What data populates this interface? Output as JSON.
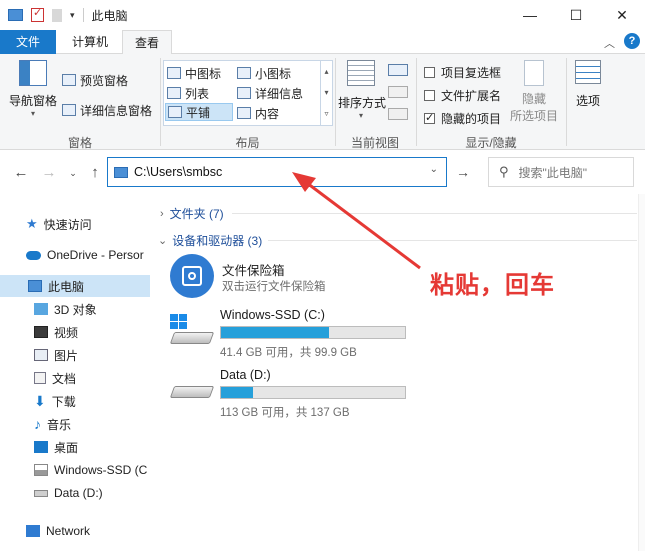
{
  "window": {
    "title": "此电脑",
    "controls": {
      "minimize": "—",
      "maximize": "☐",
      "close": "✕"
    }
  },
  "tabs": {
    "file": "文件",
    "computer": "计算机",
    "view": "查看"
  },
  "ribbon": {
    "panes": {
      "nav_pane": "导航窗格",
      "preview_pane": "预览窗格",
      "details_pane": "详细信息窗格",
      "group_label": "窗格"
    },
    "layout": {
      "items": [
        "中图标",
        "小图标",
        "列表",
        "详细信息",
        "平铺",
        "内容"
      ],
      "group_label": "布局"
    },
    "current_view": {
      "sort_by": "排序方式",
      "group_label": "当前视图"
    },
    "show_hide": {
      "item_checkboxes": "项目复选框",
      "file_extensions": "文件扩展名",
      "hidden_items": "隐藏的项目",
      "hide_selected_line1": "隐藏",
      "hide_selected_line2": "所选项目",
      "group_label": "显示/隐藏"
    },
    "options": "选项"
  },
  "address": {
    "path": "C:\\Users\\smbsc",
    "search_placeholder": "搜索\"此电脑\""
  },
  "navpane": {
    "quick_access": "快速访问",
    "onedrive": "OneDrive - Persor",
    "this_pc": "此电脑",
    "items": [
      "3D 对象",
      "视频",
      "图片",
      "文档",
      "下载",
      "音乐",
      "桌面",
      "Windows-SSD (C",
      "Data (D:)"
    ],
    "network": "Network"
  },
  "content": {
    "folders_header": "文件夹 (7)",
    "devices_header": "设备和驱动器 (3)",
    "vault": {
      "name": "文件保险箱",
      "sub": "双击运行文件保险箱"
    },
    "drives": [
      {
        "name": "Windows-SSD (C:)",
        "info": "41.4 GB 可用，共 99.9 GB",
        "used_fraction": 0.586
      },
      {
        "name": "Data (D:)",
        "info": "113 GB 可用，共 137 GB",
        "used_fraction": 0.175
      }
    ]
  },
  "annotation": "粘贴，回车",
  "colors": {
    "accent": "#1979ca",
    "annotation": "#e53935",
    "drive_fill": "#26a0da"
  }
}
